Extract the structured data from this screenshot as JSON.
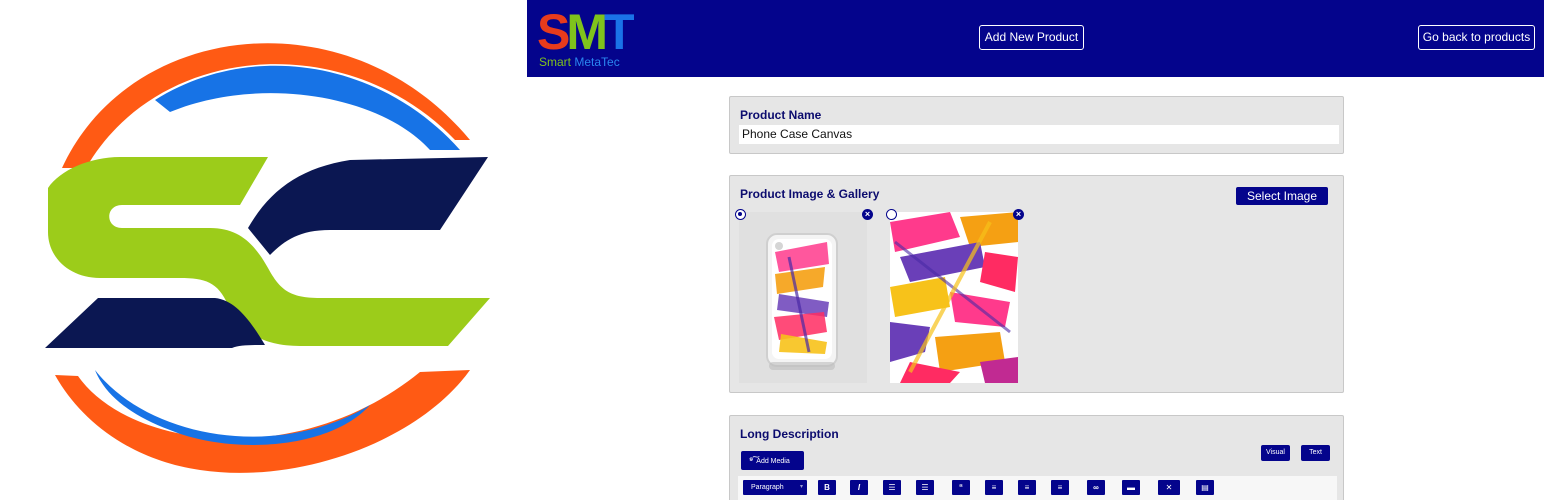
{
  "brand": {
    "letter_s": "S",
    "letter_m": "M",
    "letter_t": "T",
    "subtitle_a": "Smart ",
    "subtitle_b": "MetaTec"
  },
  "header": {
    "add_label": "Add New Product",
    "back_label": "Go back to products"
  },
  "product_name": {
    "title": "Product Name",
    "value": "Phone Case Canvas"
  },
  "gallery": {
    "title": "Product Image & Gallery",
    "select_label": "Select Image"
  },
  "description": {
    "title": "Long Description",
    "add_media_label": "Add Media",
    "visual_label": "Visual",
    "text_label": "Text",
    "format_value": "Paragraph"
  },
  "colors": {
    "header_bg": "#04048c",
    "logo_orange": "#ff5a14",
    "logo_blue": "#1773e6",
    "logo_green": "#9ccc1a",
    "logo_navy": "#0b1752"
  },
  "icons": {
    "toolbar": [
      "bold-icon",
      "italic-icon",
      "bullet-list-icon",
      "numbered-list-icon",
      "blockquote-icon",
      "align-left-icon",
      "align-center-icon",
      "align-right-icon",
      "link-icon",
      "read-more-icon",
      "fullscreen-icon",
      "toolbar-toggle-icon"
    ]
  }
}
